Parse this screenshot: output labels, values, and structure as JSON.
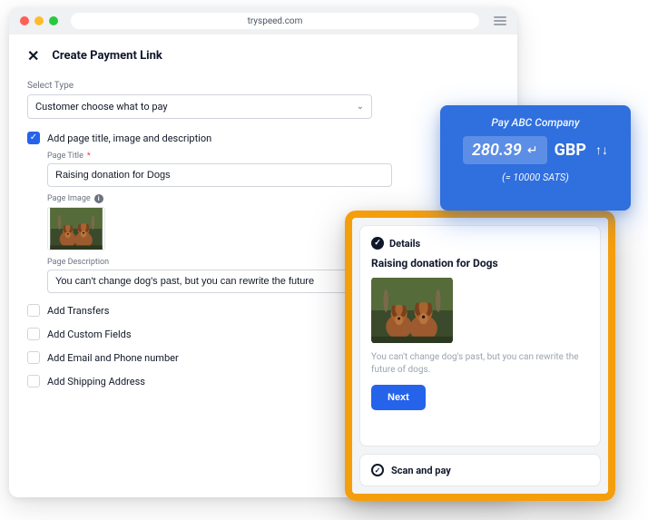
{
  "browser": {
    "address": "tryspeed.com"
  },
  "header": {
    "title": "Create Payment Link"
  },
  "form": {
    "selectTypeLabel": "Select Type",
    "selectTypeValue": "Customer choose what to pay",
    "addPageSection": {
      "checked": true,
      "label": "Add page title, image and description",
      "pageTitleLabel": "Page Title",
      "pageTitleValue": "Raising donation for Dogs",
      "pageImageLabel": "Page Image",
      "pageDescriptionLabel": "Page Description",
      "pageDescriptionValue": "You can't change dog's past, but you can rewrite the future"
    },
    "options": [
      {
        "label": "Add Transfers",
        "checked": false
      },
      {
        "label": "Add Custom Fields",
        "checked": false
      },
      {
        "label": "Add Email and Phone number",
        "checked": false
      },
      {
        "label": "Add Shipping Address",
        "checked": false
      }
    ]
  },
  "preview": {
    "detailsLabel": "Details",
    "heading": "Raising donation for Dogs",
    "description": "You can't change dog's past, but you can rewrite the future of dogs.",
    "nextLabel": "Next",
    "scanLabel": "Scan and pay"
  },
  "paycard": {
    "title": "Pay ABC Company",
    "amount": "280.39",
    "currency": "GBP",
    "sats": "(= 10000 SATS)"
  }
}
